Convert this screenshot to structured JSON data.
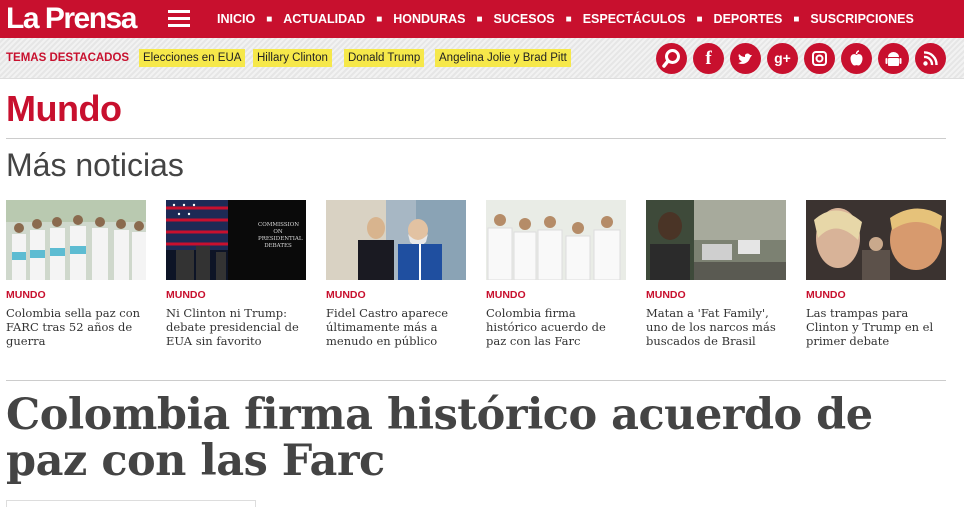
{
  "brand": {
    "logo_text": "La Prensa",
    "accent_color": "#c8102e",
    "tag_color": "#f6e84a"
  },
  "nav": {
    "items": [
      "INICIO",
      "ACTUALIDAD",
      "HONDURAS",
      "SUCESOS",
      "ESPECTÁCULOS",
      "DEPORTES",
      "SUSCRIPCIONES"
    ]
  },
  "featured": {
    "label": "TEMAS DESTACADOS",
    "tags": [
      "Elecciones en EUA",
      "Hillary Clinton",
      "Donald Trump",
      "Angelina Jolie y Brad Pitt"
    ]
  },
  "social": [
    "search-icon",
    "facebook-icon",
    "twitter-icon",
    "google-plus-icon",
    "instagram-icon",
    "apple-icon",
    "android-icon",
    "rss-icon"
  ],
  "section": {
    "title": "Mundo",
    "more_title": "Más noticias"
  },
  "cards": [
    {
      "category": "MUNDO",
      "title": "Colombia sella paz con FARC tras 52 años de guerra"
    },
    {
      "category": "MUNDO",
      "title": "Ni Clinton ni Trump: debate presidencial de EUA sin favorito"
    },
    {
      "category": "MUNDO",
      "title": "Fidel Castro aparece últimamente más a menudo en público"
    },
    {
      "category": "MUNDO",
      "title": "Colombia firma histórico acuerdo de paz con las Farc"
    },
    {
      "category": "MUNDO",
      "title": "Matan a 'Fat Family', uno de los narcos más buscados de Brasil"
    },
    {
      "category": "MUNDO",
      "title": "Las trampas para Clinton y Trump en el primer debate"
    }
  ],
  "article": {
    "headline": "Colombia firma histórico acuerdo de paz con las Farc"
  },
  "images": {
    "debate_sign_text": "COMMISSION ON PRESIDENTIAL DEBATES"
  }
}
